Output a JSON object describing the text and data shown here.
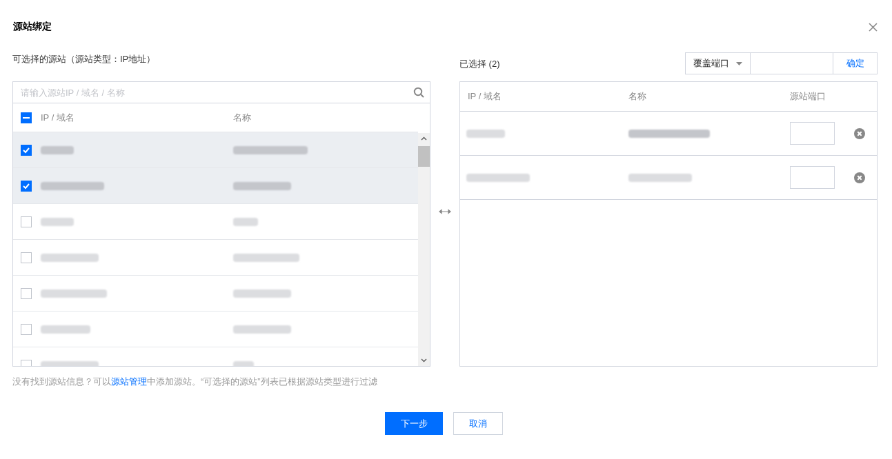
{
  "dialog": {
    "title": "源站绑定"
  },
  "available": {
    "label": "可选择的源站（源站类型：IP地址）",
    "search": {
      "placeholder": "请输入源站IP / 域名 / 名称"
    },
    "select_all": {
      "checked": true,
      "partial": true
    },
    "columns": [
      "IP / 域名",
      "名称"
    ],
    "rows": [
      {
        "checked": true,
        "redacted": true
      },
      {
        "checked": true,
        "redacted": true
      },
      {
        "checked": false,
        "redacted": true
      },
      {
        "checked": false,
        "redacted": true
      },
      {
        "checked": false,
        "redacted": true
      },
      {
        "checked": false,
        "redacted": true
      },
      {
        "checked": false,
        "redacted": true
      }
    ]
  },
  "selected": {
    "label": "已选择 (2)",
    "port_mode": {
      "value": "覆盖端口"
    },
    "confirm_button": "确定",
    "columns": [
      "IP / 域名",
      "名称",
      "源站端口"
    ],
    "rows": [
      {
        "redacted": true
      },
      {
        "redacted": true
      }
    ]
  },
  "footer": {
    "hint": "没有找到源站信息？可以",
    "link": "源站管理",
    "hint_after": "中添加源站。“可选择的源站”列表已根据源站类型进行过滤"
  },
  "buttons": [
    {
      "label": "下一步",
      "kind": "primary"
    },
    {
      "label": "取消",
      "kind": "secondary"
    }
  ]
}
